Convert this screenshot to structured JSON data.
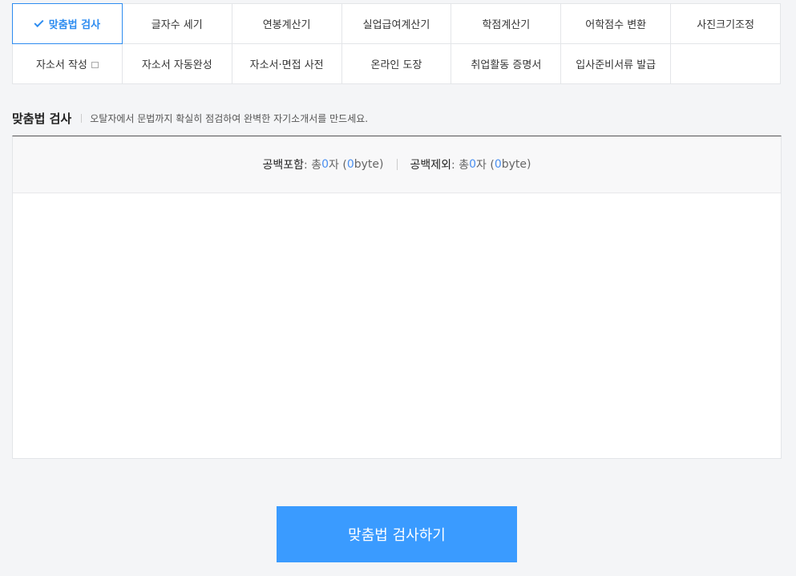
{
  "tools": [
    {
      "label": "맞춤법 검사",
      "active": true
    },
    {
      "label": "글자수 세기"
    },
    {
      "label": "연봉계산기"
    },
    {
      "label": "실업급여계산기"
    },
    {
      "label": "학점계산기"
    },
    {
      "label": "어학점수 변환"
    },
    {
      "label": "사진크기조정"
    },
    {
      "label": "자소서 작성",
      "newwin": true
    },
    {
      "label": "자소서 자동완성"
    },
    {
      "label": "자소서·면접 사전"
    },
    {
      "label": "온라인 도장"
    },
    {
      "label": "취업활동 증명서"
    },
    {
      "label": "입사준비서류 발급"
    },
    {
      "label": ""
    }
  ],
  "section": {
    "title": "맞춤법 검사",
    "description": "오탈자에서 문법까지 확실히 점검하여 완벽한 자기소개서를 만드세요."
  },
  "counter": {
    "with_space": {
      "label": "공백포함",
      "prefix": ": 총 ",
      "chars": "0",
      "chars_unit": "자 (",
      "bytes": "0",
      "bytes_unit": "byte)"
    },
    "without_space": {
      "label": "공백제외",
      "prefix": ": 총 ",
      "chars": "0",
      "chars_unit": "자 (",
      "bytes": "0",
      "bytes_unit": "byte)"
    }
  },
  "editor": {
    "value": ""
  },
  "submit_label": "맞춤법 검사하기"
}
